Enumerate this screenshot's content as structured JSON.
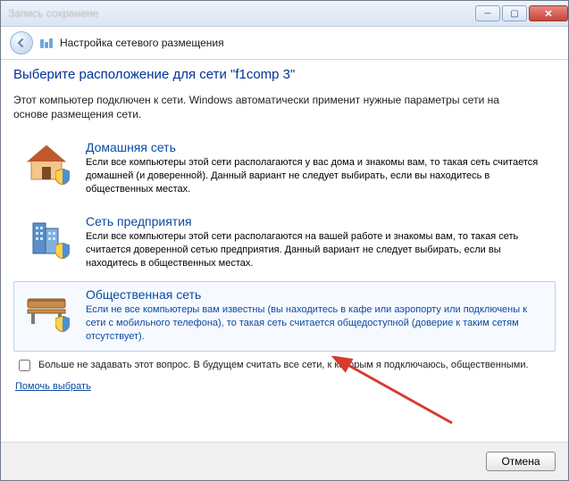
{
  "window": {
    "title_blurred": "Запись   сохранене"
  },
  "header": {
    "title": "Настройка сетевого размещения"
  },
  "main": {
    "heading": "Выберите расположение для сети \"f1comp  3\"",
    "intro": "Этот компьютер подключен к сети. Windows автоматически применит нужные параметры сети на основе размещения сети."
  },
  "options": [
    {
      "id": "home",
      "title": "Домашняя сеть",
      "desc": "Если все компьютеры этой сети располагаются у вас дома и знакомы вам, то такая сеть считается домашней (и доверенной). Данный вариант не следует выбирать, если вы находитесь в общественных местах."
    },
    {
      "id": "work",
      "title": "Сеть предприятия",
      "desc": "Если все компьютеры этой сети располагаются на вашей работе и знакомы вам, то такая сеть считается доверенной сетью предприятия. Данный вариант не следует выбирать, если вы находитесь в общественных местах."
    },
    {
      "id": "public",
      "title": "Общественная сеть",
      "desc": "Если не все компьютеры вам известны (вы находитесь в кафе или аэропорту или подключены к сети с мобильного телефона), то такая сеть считается общедоступной (доверие к таким сетям отсутствует)."
    }
  ],
  "dont_ask": "Больше не задавать этот вопрос. В будущем считать все сети, к которым я подключаюсь, общественными.",
  "help_link": "Помочь выбрать",
  "footer": {
    "cancel": "Отмена"
  }
}
